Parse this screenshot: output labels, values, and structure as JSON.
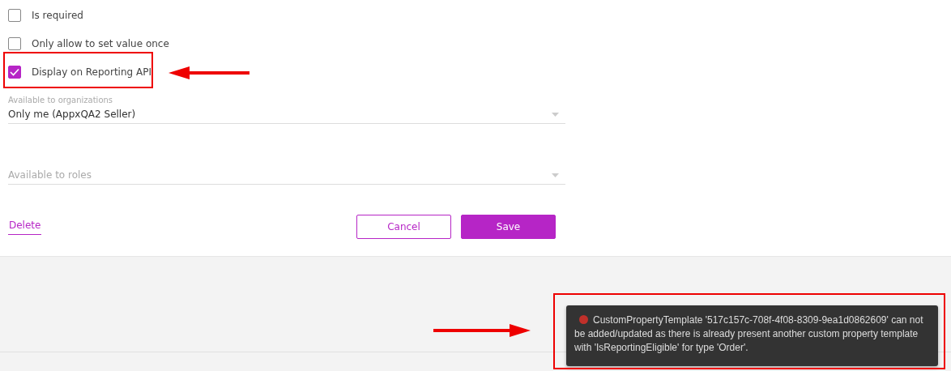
{
  "options": [
    {
      "label": "Is required",
      "checked": false
    },
    {
      "label": "Only allow to set value once",
      "checked": false
    },
    {
      "label": "Display on Reporting API",
      "checked": true
    }
  ],
  "fields": [
    {
      "label": "Available to organizations",
      "value": "Only me (AppxQA2 Seller)"
    },
    {
      "placeholder": "Available to roles"
    }
  ],
  "delete_link": "Delete",
  "buttons": [
    {
      "label": "Cancel",
      "kind": "secondary"
    },
    {
      "label": "Save",
      "kind": "primary"
    }
  ],
  "toast": {
    "message": "CustomPropertyTemplate '517c157c-708f-4f08-8309-9ea1d0862609' can not be added/updated as there is already present another custom property template with 'IsReportingEligible' for type 'Order'."
  }
}
